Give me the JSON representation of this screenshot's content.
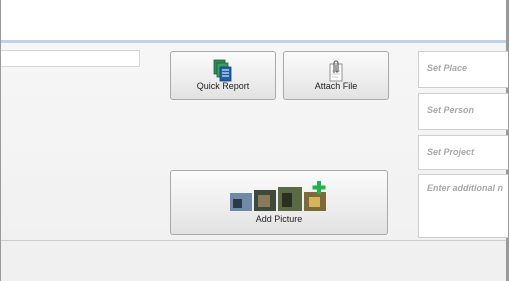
{
  "toolbar": {
    "quick_report_label": "Quick Report",
    "attach_file_label": "Attach File",
    "add_picture_label": "Add Picture"
  },
  "fields": {
    "place_placeholder": "Set Place",
    "person_placeholder": "Set Person",
    "project_placeholder": "Set Project",
    "note_placeholder": "Enter additional n"
  },
  "icons": {
    "quick_report": "stacked-documents-icon",
    "attach_file": "paperclip-document-icon",
    "add_picture": "photo-strip-add-icon"
  },
  "colors": {
    "header_accent": "#bcd3ea",
    "add_plus": "#22b14c",
    "doc_stack_green": "#2e8b57",
    "doc_stack_blue": "#1f5fa8"
  }
}
